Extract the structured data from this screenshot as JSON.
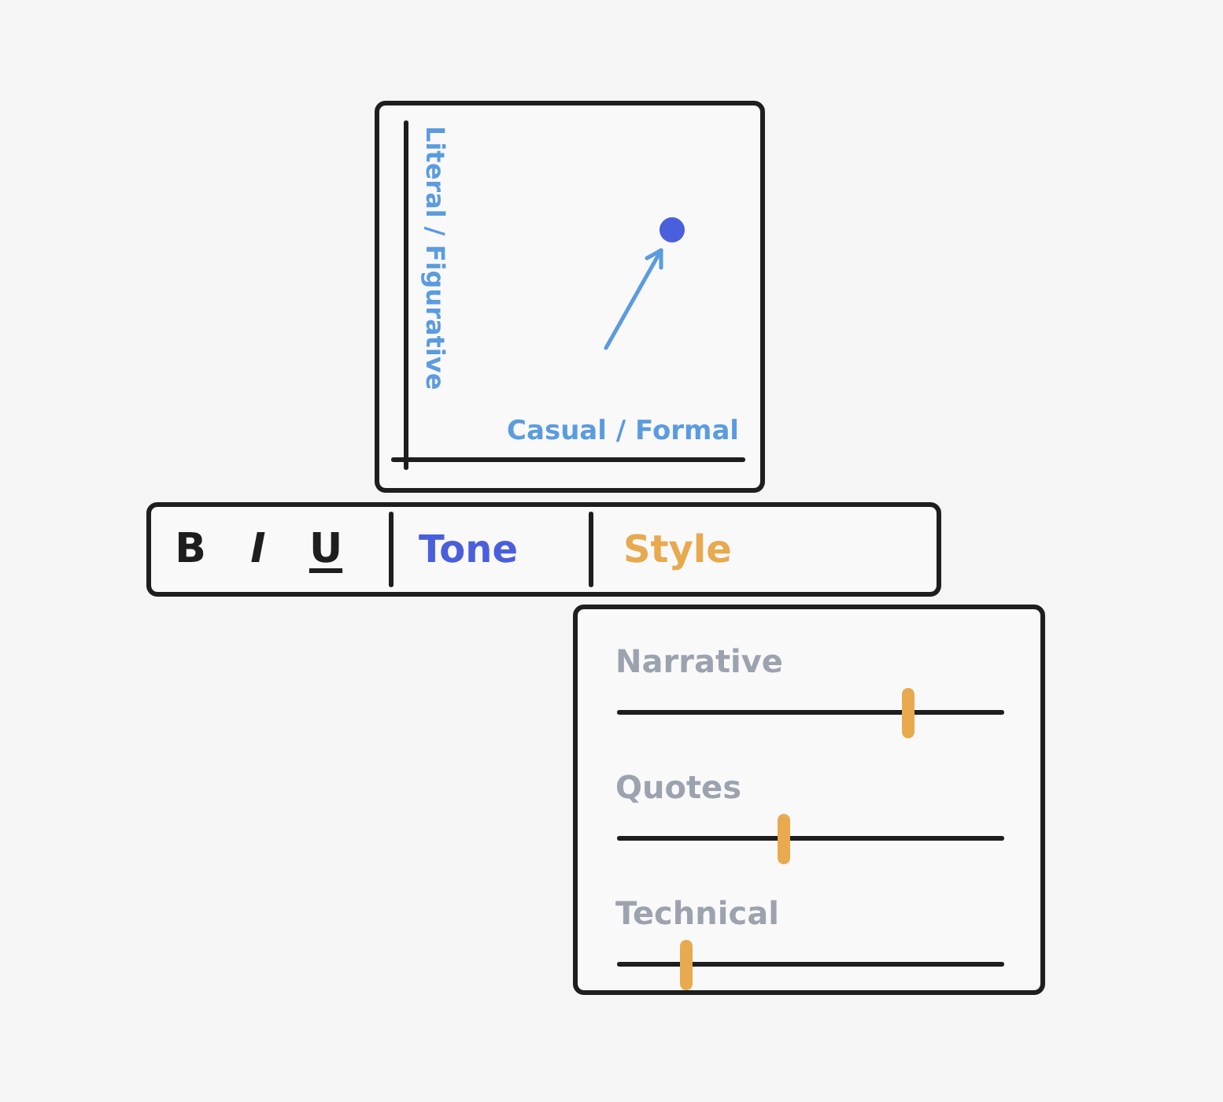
{
  "chart": {
    "ylabel": "Literal / Figurative",
    "xlabel": "Casual / Formal"
  },
  "toolbar": {
    "format_buttons": [
      {
        "label": "B",
        "kind": "bold"
      },
      {
        "label": "I",
        "kind": "italic"
      },
      {
        "label": "U",
        "kind": "underline"
      }
    ],
    "tabs": [
      {
        "label": "Tone",
        "color": "#4a5fdc"
      },
      {
        "label": "Style",
        "color": "#e8a94f"
      }
    ]
  },
  "style_panel": {
    "sliders": [
      {
        "label": "Narrative",
        "level": 0.75
      },
      {
        "label": "Quotes",
        "level": 0.43
      },
      {
        "label": "Technical",
        "level": 0.18
      }
    ]
  }
}
